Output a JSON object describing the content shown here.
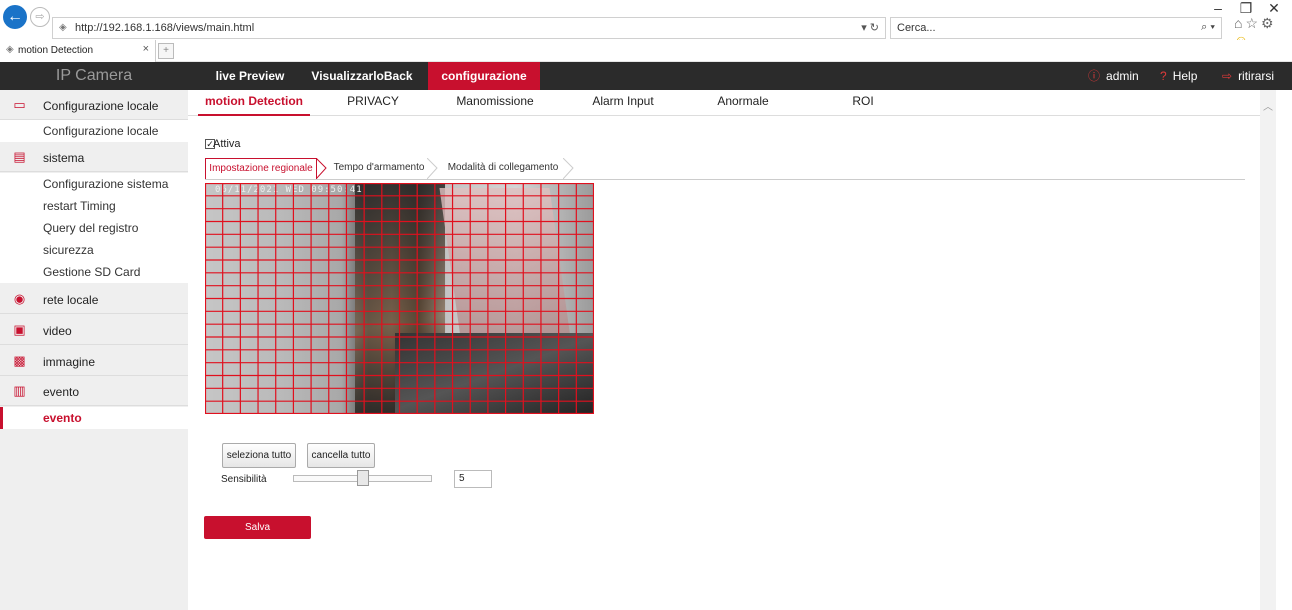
{
  "browser": {
    "url": "http://192.168.1.168/views/main.html",
    "search_placeholder": "Cerca...",
    "tab_title": "motion Detection",
    "close_glyph": "×",
    "minimize_glyph": "–",
    "restore_glyph": "❐",
    "winclose_glyph": "✕"
  },
  "header": {
    "logo": "IP Camera",
    "menu": [
      "live Preview",
      "VisualizzarloBack",
      "configurazione"
    ],
    "active_menu": "configurazione",
    "user": "admin",
    "help": "Help",
    "logout": "ritirarsi"
  },
  "sidebar": {
    "groups": [
      {
        "label": "Configurazione locale",
        "icon": "monitor-icon",
        "items": [
          "Configurazione locale"
        ]
      },
      {
        "label": "sistema",
        "icon": "system-icon",
        "items": [
          "Configurazione sistema",
          "restart Timing",
          "Query del registro",
          "sicurezza",
          "Gestione SD Card"
        ]
      },
      {
        "label": "rete locale",
        "icon": "network-icon",
        "items": []
      },
      {
        "label": "video",
        "icon": "video-icon",
        "items": []
      },
      {
        "label": "immagine",
        "icon": "image-icon",
        "items": []
      },
      {
        "label": "evento",
        "icon": "event-icon",
        "items": [
          "evento"
        ]
      }
    ],
    "active_item": "evento"
  },
  "main_tabs": [
    "motion Detection",
    "PRIVACY",
    "Manomissione",
    "Alarm Input",
    "Anormale",
    "ROI"
  ],
  "active_tab": "motion Detection",
  "enable": {
    "label": "Attiva",
    "checked": true
  },
  "sub_tabs": [
    "Impostazione regionale",
    "Tempo d'armamento",
    "Modalità di collegamento"
  ],
  "active_sub_tab": "Impostazione regionale",
  "video": {
    "osd": "06/11/2021 WED 09:50:41",
    "grid_color": "#e0101e",
    "grid_cols": 22,
    "grid_rows": 18
  },
  "buttons": {
    "select_all": "seleziona tutto",
    "clear_all": "cancella tutto",
    "save": "Salva"
  },
  "sensitivity": {
    "label": "Sensibilità",
    "value": "5",
    "level": 0.5
  },
  "colors": {
    "accent": "#c8102e",
    "header_bg": "#2b2b2b",
    "sidebar_bg": "#efefef"
  }
}
